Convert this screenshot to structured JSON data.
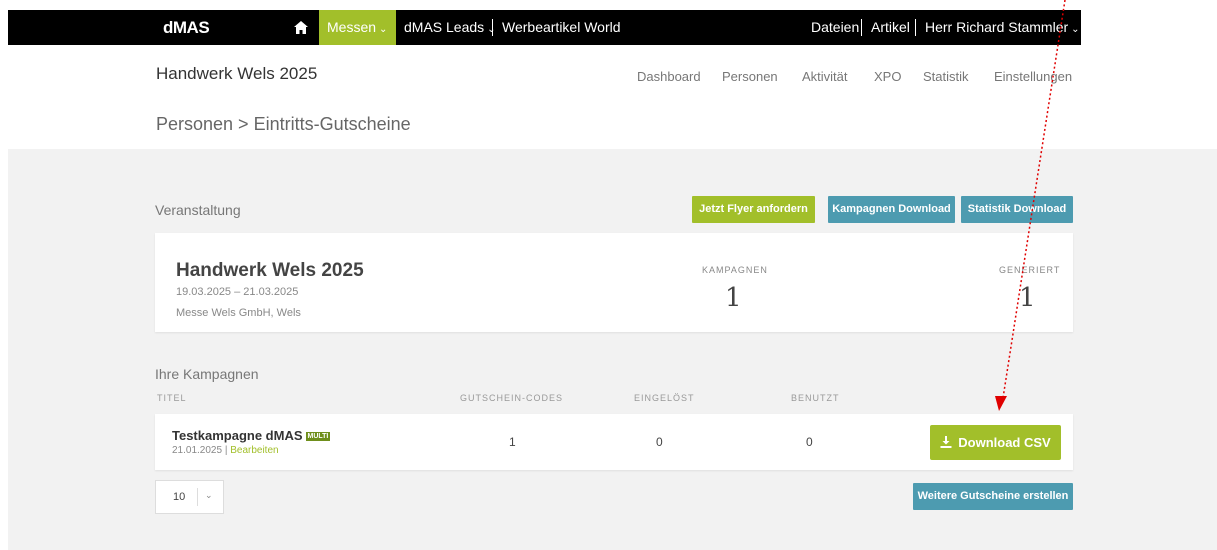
{
  "topnav": {
    "brand": "dMAS",
    "home_icon": "home-icon",
    "messen": "Messen",
    "leads": "dMAS Leads",
    "werbe": "Werbeartikel World",
    "dateien": "Dateien",
    "artikel": "Artikel",
    "user": "Herr Richard Stammler"
  },
  "header": {
    "event_title": "Handwerk Wels 2025",
    "subnav": [
      "Dashboard",
      "Personen",
      "Aktivität",
      "XPO",
      "Statistik",
      "Einstellungen"
    ],
    "breadcrumb": "Personen > Eintritts-Gutscheine"
  },
  "event_section": {
    "label": "Veranstaltung",
    "btn_flyer": "Jetzt Flyer anfordern",
    "btn_kampagnen": "Kampagnen Download",
    "btn_statistik": "Statistik Download",
    "name": "Handwerk Wels 2025",
    "dates": "19.03.2025 – 21.03.2025",
    "location": "Messe Wels GmbH, Wels",
    "kampagnen_label": "KAMPAGNEN",
    "kampagnen_value": "1",
    "generiert_label": "GENERIERT",
    "generiert_value": "1"
  },
  "campaigns": {
    "label": "Ihre Kampagnen",
    "columns": [
      "TITEL",
      "GUTSCHEIN-CODES",
      "EINGELÖST",
      "BENUTZT"
    ],
    "rows": [
      {
        "name": "Testkampagne dMAS",
        "badge": "MULTI",
        "date": "21.01.2025",
        "edit": "Bearbeiten",
        "codes": "1",
        "eingeloest": "0",
        "benutzt": "0",
        "download": "Download CSV"
      }
    ],
    "page_size": "10",
    "btn_more": "Weitere Gutscheine erstellen"
  },
  "colors": {
    "accent_green": "#a2bf2a",
    "accent_teal": "#4d9bb0",
    "annotation_arrow": "#e00000"
  }
}
